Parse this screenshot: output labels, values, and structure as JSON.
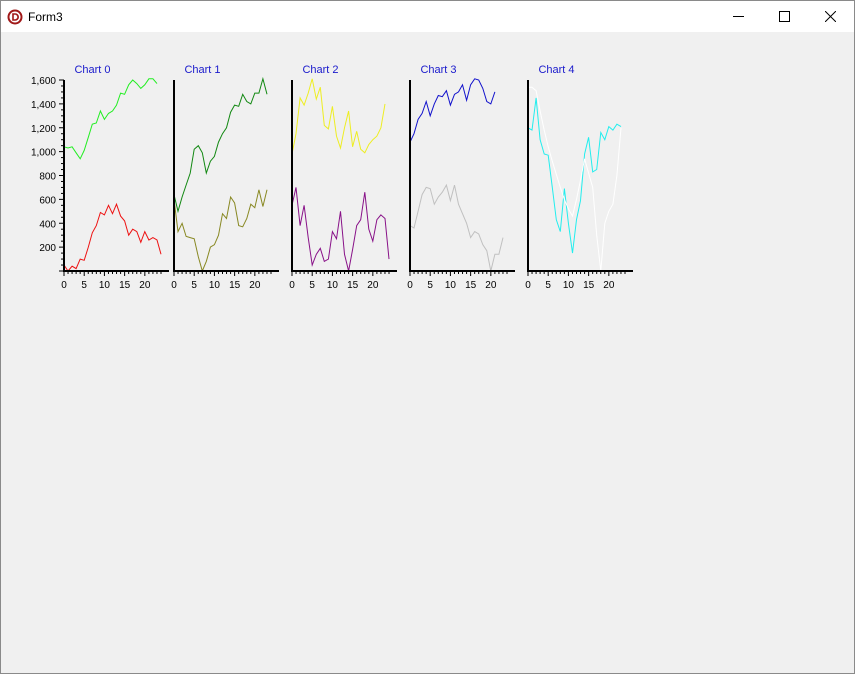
{
  "window": {
    "title": "Form3"
  },
  "icons": {
    "app": "delphi-logo-icon",
    "minimize": "minimize-icon",
    "maximize": "maximize-icon",
    "close": "close-icon"
  },
  "chart_data": [
    {
      "type": "line",
      "title": "Chart 0",
      "xlim": [
        0,
        24
      ],
      "ylim": [
        0,
        1600
      ],
      "xticks": [
        "0",
        "5",
        "10",
        "15",
        "20"
      ],
      "yticks": [
        "200",
        "400",
        "600",
        "800",
        "1,000",
        "1,200",
        "1,400",
        "1,600"
      ],
      "grid": false,
      "series": [
        {
          "color": "#22ee22",
          "values": [
            1040,
            1030,
            1040,
            990,
            940,
            1010,
            1120,
            1230,
            1240,
            1340,
            1270,
            1320,
            1340,
            1390,
            1490,
            1480,
            1560,
            1600,
            1570,
            1530,
            1560,
            1610,
            1610,
            1570
          ]
        },
        {
          "color": "#ee1111",
          "values": [
            50,
            0,
            40,
            20,
            100,
            90,
            200,
            320,
            380,
            490,
            470,
            550,
            480,
            560,
            460,
            420,
            300,
            350,
            330,
            240,
            330,
            260,
            280,
            260,
            140
          ]
        }
      ]
    },
    {
      "type": "line",
      "title": "Chart 1",
      "xlim": [
        0,
        24
      ],
      "ylim": [
        0,
        1600
      ],
      "xticks": [
        "0",
        "5",
        "10",
        "15",
        "20"
      ],
      "series": [
        {
          "color": "#118811",
          "values": [
            640,
            500,
            620,
            720,
            820,
            1020,
            1050,
            990,
            820,
            920,
            960,
            1080,
            1150,
            1200,
            1330,
            1390,
            1380,
            1480,
            1420,
            1400,
            1490,
            1490,
            1610,
            1480
          ]
        },
        {
          "color": "#888822",
          "values": [
            600,
            330,
            400,
            290,
            280,
            270,
            120,
            0,
            80,
            200,
            220,
            300,
            480,
            440,
            620,
            570,
            380,
            370,
            440,
            560,
            530,
            680,
            540,
            680
          ]
        }
      ]
    },
    {
      "type": "line",
      "title": "Chart 2",
      "xlim": [
        0,
        24
      ],
      "ylim": [
        0,
        1600
      ],
      "xticks": [
        "0",
        "5",
        "10",
        "15",
        "20"
      ],
      "series": [
        {
          "color": "#eeee22",
          "values": [
            980,
            1150,
            1450,
            1390,
            1490,
            1610,
            1440,
            1540,
            1220,
            1190,
            1380,
            1130,
            1030,
            1200,
            1340,
            1040,
            1170,
            1020,
            990,
            1060,
            1100,
            1130,
            1200,
            1400
          ]
        },
        {
          "color": "#881188",
          "values": [
            550,
            700,
            380,
            550,
            280,
            50,
            140,
            190,
            80,
            100,
            330,
            270,
            500,
            140,
            0,
            180,
            380,
            430,
            660,
            350,
            250,
            430,
            470,
            440,
            100
          ]
        }
      ]
    },
    {
      "type": "line",
      "title": "Chart 3",
      "xlim": [
        0,
        24
      ],
      "ylim": [
        0,
        1600
      ],
      "xticks": [
        "0",
        "5",
        "10",
        "15",
        "20"
      ],
      "series": [
        {
          "color": "#1111cc",
          "values": [
            1080,
            1150,
            1270,
            1320,
            1420,
            1300,
            1400,
            1470,
            1460,
            1510,
            1390,
            1480,
            1500,
            1560,
            1430,
            1560,
            1610,
            1600,
            1530,
            1420,
            1400,
            1500
          ]
        },
        {
          "color": "#c0c0c0",
          "values": [
            380,
            360,
            500,
            640,
            700,
            690,
            560,
            620,
            660,
            720,
            590,
            720,
            560,
            480,
            400,
            280,
            330,
            310,
            220,
            170,
            0,
            140,
            140,
            280
          ]
        }
      ]
    },
    {
      "type": "line",
      "title": "Chart 4",
      "xlim": [
        0,
        24
      ],
      "ylim": [
        0,
        1600
      ],
      "xticks": [
        "0",
        "5",
        "10",
        "15",
        "20"
      ],
      "series": [
        {
          "color": "#22eeee",
          "values": [
            1200,
            1180,
            1450,
            1100,
            980,
            970,
            700,
            430,
            330,
            690,
            400,
            150,
            430,
            590,
            980,
            1120,
            830,
            850,
            1160,
            1100,
            1210,
            1180,
            1230,
            1210
          ]
        },
        {
          "color": "#ffffff",
          "values": [
            1540,
            1540,
            1510,
            1340,
            1180,
            1040,
            920,
            810,
            700,
            600,
            520,
            460,
            600,
            760,
            940,
            820,
            700,
            300,
            0,
            400,
            500,
            560,
            800,
            1200
          ]
        }
      ]
    }
  ]
}
